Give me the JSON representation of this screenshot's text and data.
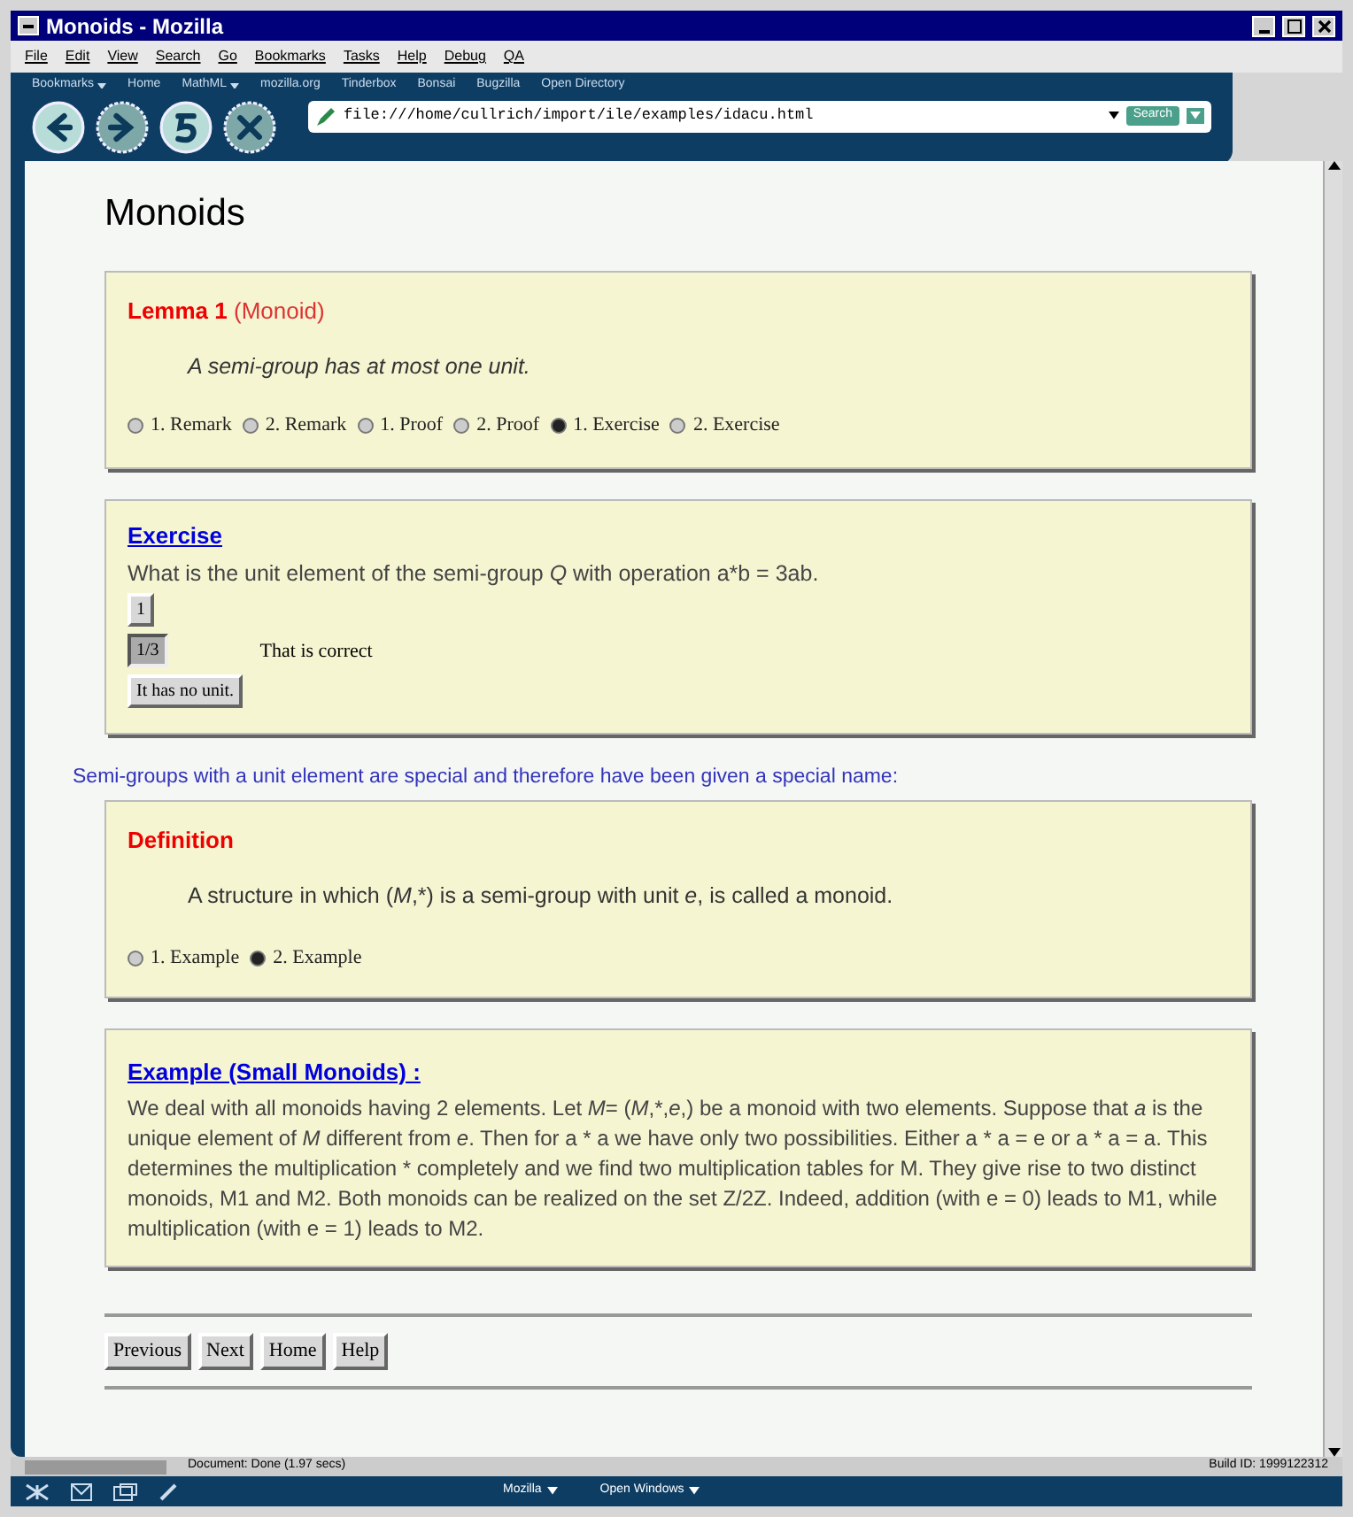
{
  "window": {
    "title": "Monoids - Mozilla"
  },
  "menu": [
    "File",
    "Edit",
    "View",
    "Search",
    "Go",
    "Bookmarks",
    "Tasks",
    "Help",
    "Debug",
    "QA"
  ],
  "personal_bar": [
    {
      "label": "Bookmarks",
      "dropdown": true
    },
    {
      "label": "Home",
      "dropdown": false
    },
    {
      "label": "MathML",
      "dropdown": true
    },
    {
      "label": "mozilla.org",
      "dropdown": false
    },
    {
      "label": "Tinderbox",
      "dropdown": false
    },
    {
      "label": "Bonsai",
      "dropdown": false
    },
    {
      "label": "Bugzilla",
      "dropdown": false
    },
    {
      "label": "Open Directory",
      "dropdown": false
    }
  ],
  "nav_buttons": [
    {
      "kind": "back",
      "disabled": false
    },
    {
      "kind": "forward",
      "disabled": true
    },
    {
      "kind": "reload",
      "disabled": false
    },
    {
      "kind": "stop",
      "disabled": true
    }
  ],
  "address": {
    "value": "file:///home/cullrich/import/ile/examples/idacu.html"
  },
  "search_button": "Search",
  "page": {
    "heading": "Monoids",
    "lemma": {
      "label": "Lemma 1",
      "name": "(Monoid)",
      "statement": "A semi-group has at most one unit.",
      "options": [
        {
          "label": "1. Remark",
          "selected": false
        },
        {
          "label": "2. Remark",
          "selected": false
        },
        {
          "label": "1. Proof",
          "selected": false
        },
        {
          "label": "2. Proof",
          "selected": false
        },
        {
          "label": "1. Exercise",
          "selected": true
        },
        {
          "label": "2. Exercise",
          "selected": false
        }
      ]
    },
    "exercise": {
      "title": "Exercise",
      "question": [
        {
          "text": "What is the unit element of the semi-group "
        },
        {
          "text": "Q",
          "italic": true
        },
        {
          "text": " with operation a*b = 3ab."
        }
      ],
      "answers": [
        {
          "label": "1",
          "pressed": false
        },
        {
          "label": "1/3",
          "pressed": true,
          "feedback": "That is correct"
        },
        {
          "label": "It has no unit.",
          "pressed": false
        }
      ]
    },
    "transition": "Semi-groups with a unit element are special and therefore have been given a special name:",
    "definition": {
      "label": "Definition",
      "statement": [
        {
          "text": "A structure in which ("
        },
        {
          "text": "M",
          "italic": true
        },
        {
          "text": ",*) is a semi-group with unit "
        },
        {
          "text": "e",
          "italic": true
        },
        {
          "text": ", is called a monoid."
        }
      ],
      "options": [
        {
          "label": "1. Example",
          "selected": false
        },
        {
          "label": "2. Example",
          "selected": true
        }
      ]
    },
    "example": {
      "title": "Example (Small Monoids) :",
      "body": [
        {
          "text": "We deal with all monoids having 2 elements. Let "
        },
        {
          "text": "M",
          "italic": true
        },
        {
          "text": "= ("
        },
        {
          "text": "M",
          "italic": true
        },
        {
          "text": ",*,"
        },
        {
          "text": "e",
          "italic": true
        },
        {
          "text": ",) be a monoid with two elements. Suppose that "
        },
        {
          "text": "a",
          "italic": true
        },
        {
          "text": " is the unique element of "
        },
        {
          "text": "M",
          "italic": true
        },
        {
          "text": " different from "
        },
        {
          "text": "e",
          "italic": true
        },
        {
          "text": ". Then for a * a we have only two possibilities. Either a * a = e or a * a = a. This determines the multiplication * completely and we find two multiplication tables for M. They give rise to two distinct monoids, M1 and M2. Both monoids can be realized on the set Z/2Z. Indeed, addition (with e = 0) leads to M1, while multiplication (with e = 1) leads to M2."
        }
      ]
    },
    "footer_buttons": [
      "Previous",
      "Next",
      "Home",
      "Help"
    ]
  },
  "status_bar": {
    "message": "Document: Done (1.97 secs)",
    "build": "Build ID: 1999122312"
  },
  "taskbar": {
    "menus": [
      "Mozilla",
      "Open Windows"
    ]
  }
}
